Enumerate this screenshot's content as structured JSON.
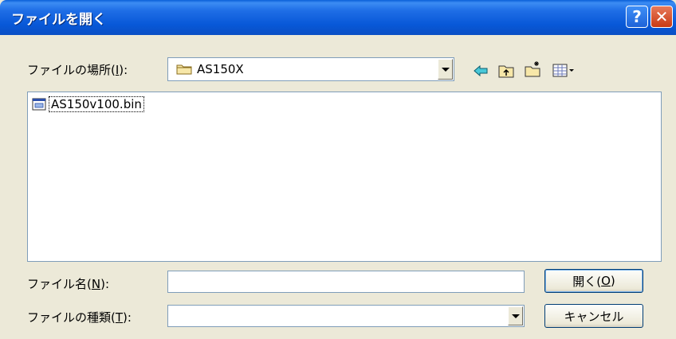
{
  "window": {
    "title": "ファイルを開く"
  },
  "titlebar": {
    "help_glyph": "?",
    "close_glyph": "✕"
  },
  "look_in": {
    "label": "ファイルの場所(",
    "accel": "I",
    "label_end": "):",
    "value": "AS150X"
  },
  "toolbar": {
    "icons": [
      "back-arrow-icon",
      "up-folder-icon",
      "new-folder-icon",
      "view-menu-icon"
    ]
  },
  "files": [
    {
      "name": "AS150v100.bin",
      "icon": "bin-file-icon"
    }
  ],
  "filename": {
    "label": "ファイル名(",
    "accel": "N",
    "label_end": "):",
    "value": ""
  },
  "filetype": {
    "label": "ファイルの種類(",
    "accel": "T",
    "label_end": "):",
    "value": ""
  },
  "buttons": {
    "open_label": "開く(",
    "open_accel": "O",
    "open_end": ")",
    "cancel_label": "キャンセル"
  },
  "colors": {
    "titlebar": "#0a58d8",
    "close": "#c83a14",
    "face": "#ece9d8",
    "border": "#7f9db9"
  }
}
